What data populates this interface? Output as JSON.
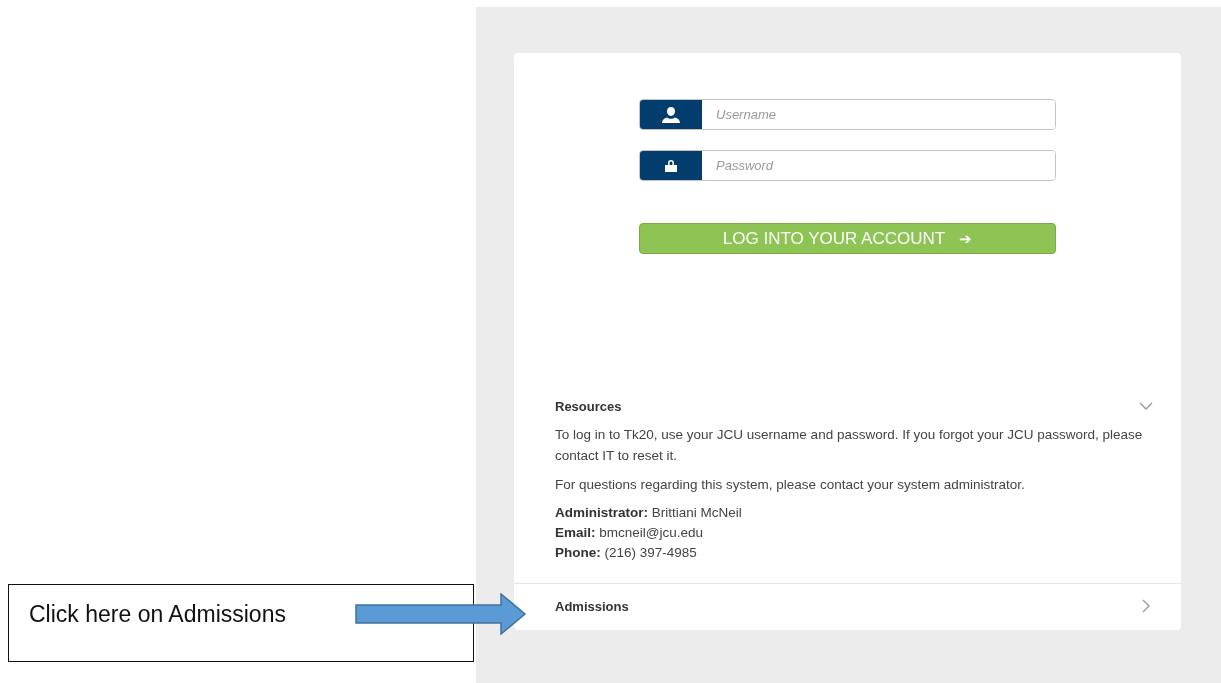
{
  "login": {
    "fields": [
      {
        "kind": "user",
        "placeholder": "Username"
      },
      {
        "kind": "lock",
        "placeholder": "Password"
      }
    ],
    "button": {
      "label": "LOG INTO YOUR ACCOUNT",
      "arrow": "➔"
    }
  },
  "sections": [
    {
      "title": "Resources",
      "expanded": true,
      "paragraphs": [
        "To log in to Tk20, use your JCU username and password. If you forgot your JCU password, please contact IT to reset it.",
        "For questions regarding this system, please contact your system administrator."
      ],
      "contacts": [
        {
          "label": "Administrator:",
          "value": "Brittiani McNeil"
        },
        {
          "label": "Email:",
          "value": "bmcneil@jcu.edu"
        },
        {
          "label": "Phone:",
          "value": "(216) 397-4985"
        }
      ]
    },
    {
      "title": "Admissions",
      "expanded": false
    }
  ],
  "callout": {
    "text": "Click here on Admissions"
  }
}
